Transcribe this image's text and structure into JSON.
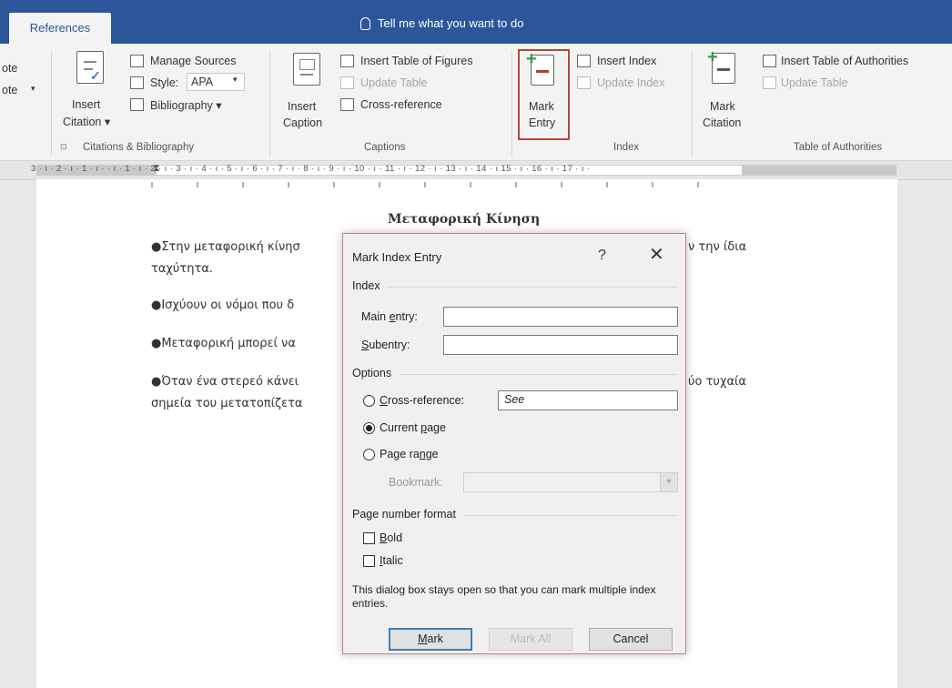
{
  "ribbon": {
    "active_tab": "References",
    "tell_me": "Tell me what you want to do",
    "partial_left": {
      "item1": "ote",
      "item2": "ote",
      "item2_arrow": "▾"
    },
    "citations": {
      "insert_citation_line1": "Insert",
      "insert_citation_line2": "Citation ▾",
      "manage_sources": "Manage Sources",
      "style_label": "Style:",
      "style_value": "APA",
      "bibliography": "Bibliography ▾",
      "group_label": "Citations & Bibliography"
    },
    "captions": {
      "insert_caption_line1": "Insert",
      "insert_caption_line2": "Caption",
      "insert_table_of_figures": "Insert Table of Figures",
      "update_table": "Update Table",
      "cross_reference": "Cross-reference",
      "group_label": "Captions"
    },
    "index": {
      "mark_entry_line1": "Mark",
      "mark_entry_line2": "Entry",
      "insert_index": "Insert Index",
      "update_index": "Update Index",
      "group_label": "Index"
    },
    "authorities": {
      "mark_citation_line1": "Mark",
      "mark_citation_line2": "Citation",
      "insert_table_of_authorities": "Insert Table of Authorities",
      "update_table": "Update Table",
      "group_label": "Table of Authorities"
    }
  },
  "ruler": {
    "numbers": "3 · ı · 2 · ı · 1 · ı ·   · ı · 1 · ı · 2 · ı · 3 · ı · 4 · ı · 5 · ı · 6 · ı · 7 · ı · 8 · ı · 9 · ı · 10 · ı · 11 · ı · 12 · ı · 13 · ı · 14 · ı  15 · ı · 16 · ı · 17 · ı ·"
  },
  "document": {
    "title": "Μεταφορική Κίνηση",
    "p1_left": "●Στην μεταφορική κίνησ",
    "p1_right": "ν την ίδια",
    "p1_line2": "ταχύτητα.",
    "p2_left": "●Ισχύουν οι νόμοι που δ",
    "p3_left": "●Μεταφορική μπορεί να",
    "p4_left": "●Όταν ένα στερεό κάνει",
    "p4_right": "ύο τυχαία",
    "p4_line2": "σημεία του μετατοπίζετα"
  },
  "dialog": {
    "title": "Mark Index Entry",
    "help": "?",
    "close": "✕",
    "index_section": "Index",
    "main_entry_pre": "Main ",
    "main_entry_u": "e",
    "main_entry_post": "ntry:",
    "main_entry_value": "",
    "subentry_u": "S",
    "subentry_post": "ubentry:",
    "subentry_value": "",
    "options_section": "Options",
    "cross_ref_u": "C",
    "cross_ref_post": "ross-reference:",
    "cross_ref_value": "See",
    "current_page_pre": "Current ",
    "current_page_u": "p",
    "current_page_post": "age",
    "page_range_pre": "Page ra",
    "page_range_u": "n",
    "page_range_post": "ge",
    "bookmark_label": "Bookmark:",
    "bookmark_value": "",
    "page_number_format": "Page number format",
    "bold_u": "B",
    "bold_post": "old",
    "italic_u": "I",
    "italic_post": "talic",
    "note": "This dialog box stays open so that you can mark multiple index entries.",
    "mark_u": "M",
    "mark_post": "ark",
    "mark_all": "Mark All",
    "cancel": "Cancel",
    "selected_option": "current_page",
    "bold_checked": false,
    "italic_checked": false
  },
  "colors": {
    "ribbon_blue": "#2b579a",
    "mark_entry_highlight": "#b5483b",
    "add_green": "#3a9a46",
    "remove_red": "#c0392b"
  }
}
